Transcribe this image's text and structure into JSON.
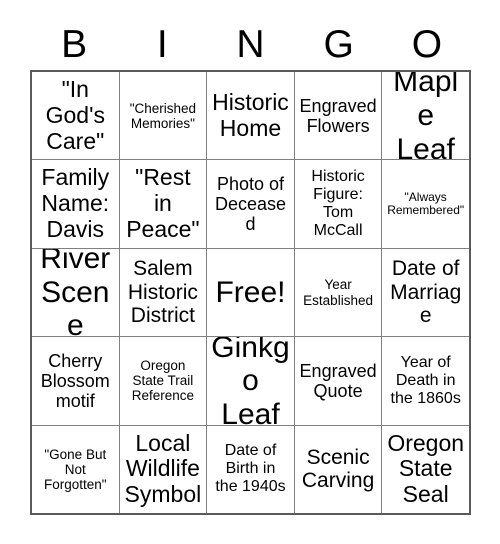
{
  "card": {
    "title_letters": [
      "B",
      "I",
      "N",
      "G",
      "O"
    ],
    "rows": [
      [
        {
          "text": "\"In\nGod's\nCare\"",
          "size": "fs-xl"
        },
        {
          "text": "\"Cherished\nMemories\"",
          "size": "fs-xs"
        },
        {
          "text": "Historic\nHome",
          "size": "fs-xl"
        },
        {
          "text": "Engraved\nFlowers",
          "size": "fs-md"
        },
        {
          "text": "Maple\nLeaf",
          "size": "fs-xxl"
        }
      ],
      [
        {
          "text": "Family\nName:\nDavis",
          "size": "fs-xl"
        },
        {
          "text": "\"Rest\nin\nPeace\"",
          "size": "fs-xl"
        },
        {
          "text": "Photo of\nDeceased",
          "size": "fs-md"
        },
        {
          "text": "Historic\nFigure:\nTom\nMcCall",
          "size": "fs-sm"
        },
        {
          "text": "\"Always\nRemembered\"",
          "size": "fs-xxs"
        }
      ],
      [
        {
          "text": "River\nScene",
          "size": "fs-xxl"
        },
        {
          "text": "Salem\nHistoric\nDistrict",
          "size": "fs-lg"
        },
        {
          "text": "Free!",
          "size": "fs-xxl"
        },
        {
          "text": "Year\nEstablished",
          "size": "fs-xs"
        },
        {
          "text": "Date of\nMarriage",
          "size": "fs-lg"
        }
      ],
      [
        {
          "text": "Cherry\nBlossom\nmotif",
          "size": "fs-md"
        },
        {
          "text": "Oregon\nState Trail\nReference",
          "size": "fs-xs"
        },
        {
          "text": "Ginkgo\nLeaf",
          "size": "fs-xxl"
        },
        {
          "text": "Engraved\nQuote",
          "size": "fs-md"
        },
        {
          "text": "Year of\nDeath in\nthe 1860s",
          "size": "fs-sm"
        }
      ],
      [
        {
          "text": "\"Gone But\nNot\nForgotten\"",
          "size": "fs-xs"
        },
        {
          "text": "Local\nWildlife\nSymbol",
          "size": "fs-xl"
        },
        {
          "text": "Date of\nBirth in\nthe 1940s",
          "size": "fs-sm"
        },
        {
          "text": "Scenic\nCarving",
          "size": "fs-lg"
        },
        {
          "text": "Oregon\nState\nSeal",
          "size": "fs-xl"
        }
      ]
    ],
    "colors": {
      "outer_border": "#5a5a5a",
      "inner_border": "#808080",
      "text": "#000000",
      "background": "#ffffff"
    }
  }
}
